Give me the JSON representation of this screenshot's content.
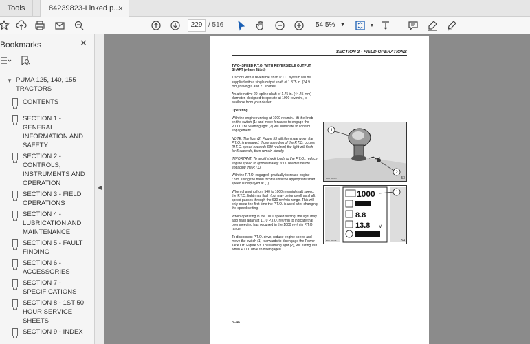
{
  "tabs": {
    "tools": "Tools",
    "document": "84239823-Linked p...",
    "close": "×"
  },
  "toolbar": {
    "current_page": "229",
    "total_pages": "/  516",
    "zoom": "54.5%",
    "icons": [
      "star-icon",
      "upload-icon",
      "print-icon",
      "mail-icon",
      "zoom-search-icon",
      "page-up-icon",
      "page-down-icon",
      "select-cursor-icon",
      "hand-tool-icon",
      "zoom-out-icon",
      "zoom-in-icon",
      "fit-page-icon",
      "scroll-mode-icon",
      "comment-icon",
      "highlight-icon",
      "sign-icon"
    ]
  },
  "sidebar": {
    "title": "Bookmarks",
    "close": "✕",
    "items": [
      {
        "label": "PUMA 125, 140, 155 TRACTORS",
        "root": true
      },
      {
        "label": "CONTENTS"
      },
      {
        "label": "SECTION 1 - GENERAL INFORMATION AND SAFETY"
      },
      {
        "label": "SECTION 2 - CONTROLS, INSTRUMENTS AND OPERATION"
      },
      {
        "label": "SECTION 3 - FIELD OPERATIONS"
      },
      {
        "label": "SECTION 4 - LUBRICATION AND MAINTENANCE"
      },
      {
        "label": "SECTION 5 - FAULT FINDING"
      },
      {
        "label": "SECTION 6 - ACCESSORIES"
      },
      {
        "label": "SECTION 7 - SPECIFICATIONS"
      },
      {
        "label": "SECTION 8 - 1ST 50 HOUR SERVICE SHEETS"
      },
      {
        "label": "SECTION 9 - INDEX"
      }
    ]
  },
  "document": {
    "header": "SECTION 3  - FIELD OPERATIONS",
    "heading": "TWO–SPEED P.T.O. WITH REVERSIBLE OUTPUT SHAFT (where fitted)",
    "p1": "Tractors with a reversible shaft P.T.O. system will be supplied with a single output shaft of 1.375 in. (34.9 mm) having 6 and 21 splines.",
    "p2": "An alternative 20–spline shaft of 1.75 in. (44.45 mm) diameter, designed to operate at 1000 rev/min., is available from your dealer.",
    "operating": "Operating",
    "p3": "With the engine running at 1000 rev/min., lift the knob on the switch (1) and move forwards to engage the P.T.O. The warning light (2) will illuminate to confirm engagement.",
    "note": "NOTE: The light (2) Figure 53 will illuminate when the P.T.O. is engaged. If overspeeding of the P.T.O. occurs (P.T.O. speed exceeds 630 rev/min) the light will flash for 5 seconds, then remain steady.",
    "important": "IMPORTANT: To avoid shock loads to the P.T.O., reduce engine speed to approximately 1000 rev/min before engaging the P.T.O.",
    "p4": "With the P.T.O. engaged, gradually increase engine r.p.m. using the hand throttle until the appropriate shaft speed is displayed at (1).",
    "p5": "When changing from 540 to 1000 rev/min/shaft speed, the P.T.O. light may flash (but may be ignored) as shaft speed passes through the 630 rev/min range. This will only occur the first time the P.T.O. is used after changing the speed setting.",
    "p6": "When operating in the 1000 speed setting, the light may also flash again at 1170 P.T.O. rev/min to indicate that overspeeding has occurred in the 1000 rev/min P.T.O. range.",
    "p7": "To disconnect P.T.O. drive, reduce engine speed and move the switch (1) rearwards to disengage the Power Take Off, Figure 53. The warning light (2), will extinguish when P.T.O. drive to disengaged.",
    "fig1_num": "53",
    "fig2_num": "54",
    "fig1_code": "BDA 3603B",
    "fig2_code": "BDA 3603B",
    "callout_1": "1",
    "callout_2": "2",
    "display_1000": "1000",
    "display_88": "8.8",
    "display_138": "13.8",
    "display_v": "V",
    "page_number": "3–46"
  }
}
